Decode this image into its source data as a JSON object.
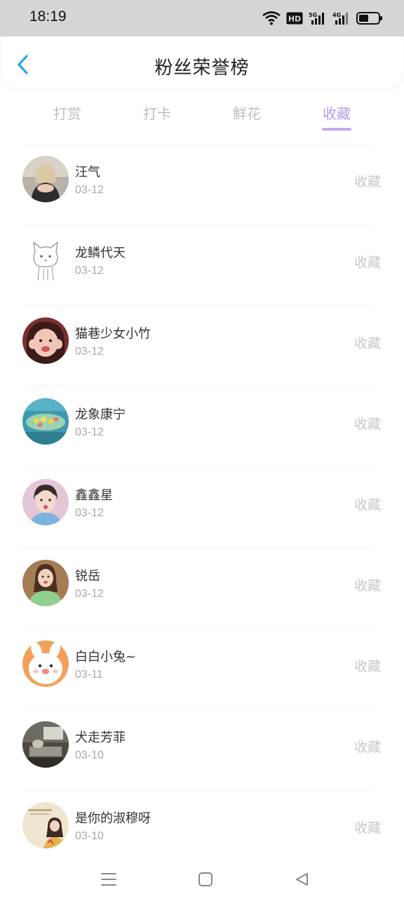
{
  "status_bar": {
    "time": "18:19",
    "icons": [
      "wifi-icon",
      "hd-icon",
      "signal-5g-icon",
      "signal-4g-icon",
      "battery-icon"
    ],
    "hd_label": "HD",
    "net1_label": "5G",
    "net2_label": "4G"
  },
  "header": {
    "title": "粉丝荣誉榜",
    "back_icon": "chevron-left-icon"
  },
  "tabs": [
    {
      "label": "打赏",
      "active": false
    },
    {
      "label": "打卡",
      "active": false
    },
    {
      "label": "鲜花",
      "active": false
    },
    {
      "label": "收藏",
      "active": true
    }
  ],
  "fans": [
    {
      "name": "汪气",
      "date": "03-12",
      "tag": "收藏"
    },
    {
      "name": "龙鳞代天",
      "date": "03-12",
      "tag": "收藏"
    },
    {
      "name": "猫巷少女小竹",
      "date": "03-12",
      "tag": "收藏"
    },
    {
      "name": "龙象康宁",
      "date": "03-12",
      "tag": "收藏"
    },
    {
      "name": "鑫鑫星",
      "date": "03-12",
      "tag": "收藏"
    },
    {
      "name": "锐岳",
      "date": "03-12",
      "tag": "收藏"
    },
    {
      "name": "白白小兔~",
      "date": "03-11",
      "tag": "收藏"
    },
    {
      "name": "犬走芳菲",
      "date": "03-10",
      "tag": "收藏"
    },
    {
      "name": "是你的淑穆呀",
      "date": "03-10",
      "tag": "收藏"
    }
  ],
  "colors": {
    "accent": "#b79be6",
    "back_arrow": "#2aa5e8",
    "status_bar_bg": "#d6d6d6"
  },
  "nav_bar": {
    "icons": [
      "menu-icon",
      "home-square-icon",
      "back-triangle-icon"
    ]
  }
}
